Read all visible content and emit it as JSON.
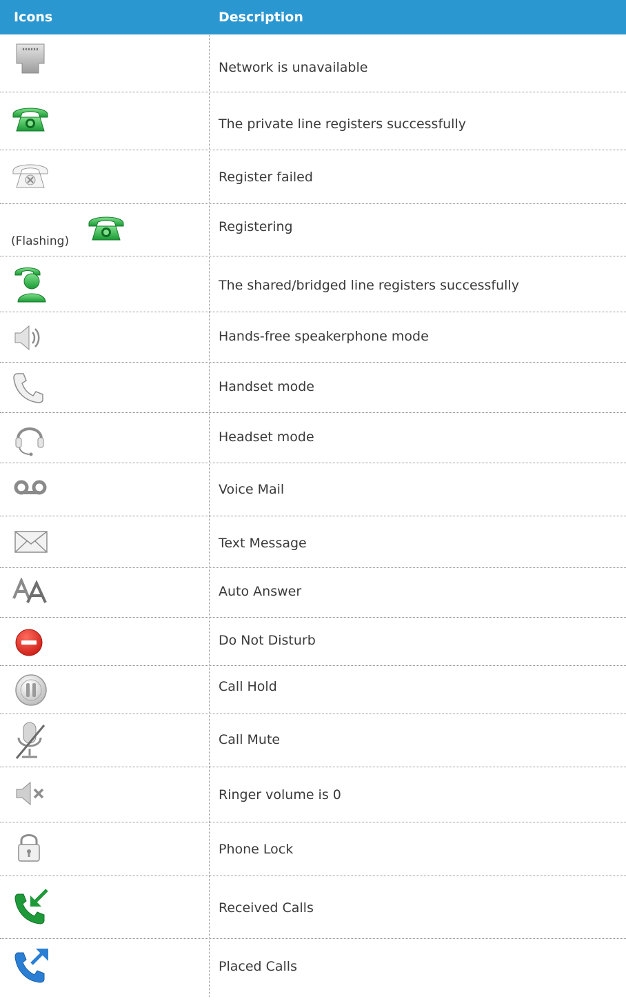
{
  "header": {
    "icons": "Icons",
    "description": "Description"
  },
  "rows": [
    {
      "icon": "network-port-icon",
      "description": "Network is unavailable"
    },
    {
      "icon": "green-phone-icon",
      "description": "The private line registers successfully"
    },
    {
      "icon": "failed-phone-icon",
      "description": "Register failed"
    },
    {
      "icon": "green-phone-icon",
      "prefix": "(Flashing)",
      "description": "Registering"
    },
    {
      "icon": "shared-line-icon",
      "description": "The shared/bridged line registers successfully"
    },
    {
      "icon": "speaker-icon",
      "description": "Hands-free speakerphone mode"
    },
    {
      "icon": "handset-icon",
      "description": "Handset mode"
    },
    {
      "icon": "headset-icon",
      "description": "Headset mode"
    },
    {
      "icon": "voicemail-icon",
      "description": "Voice Mail"
    },
    {
      "icon": "envelope-icon",
      "description": "Text Message"
    },
    {
      "icon": "auto-answer-icon",
      "description": "Auto Answer"
    },
    {
      "icon": "do-not-disturb-icon",
      "description": "Do Not Disturb"
    },
    {
      "icon": "pause-icon",
      "description": "Call Hold"
    },
    {
      "icon": "muted-mic-icon",
      "description": "Call Mute"
    },
    {
      "icon": "speaker-muted-icon",
      "description": "Ringer volume is 0"
    },
    {
      "icon": "padlock-icon",
      "description": "Phone Lock"
    },
    {
      "icon": "received-call-icon",
      "description": "Received Calls"
    },
    {
      "icon": "placed-call-icon",
      "description": "Placed Calls"
    }
  ],
  "colors": {
    "header_bg": "#2b97d1",
    "green": "#2fb84a",
    "blue": "#2a7fd4",
    "red": "#d9241c"
  }
}
